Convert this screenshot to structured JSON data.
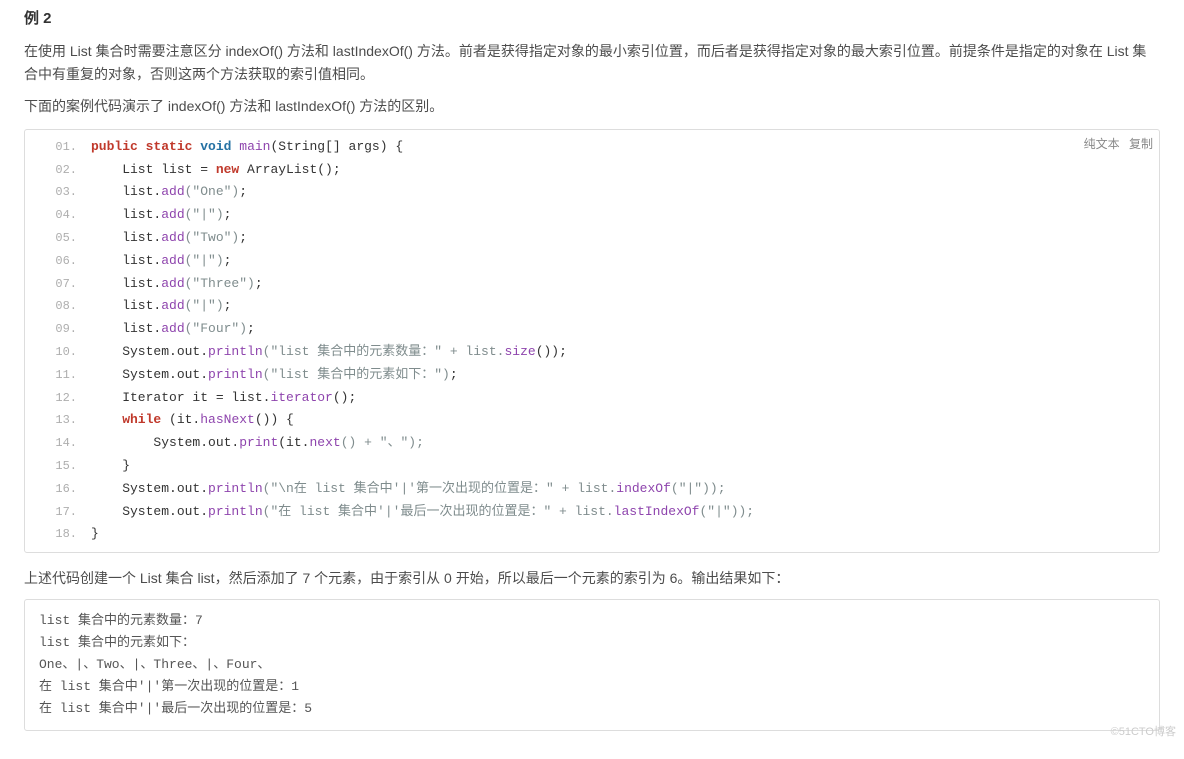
{
  "heading": "例 2",
  "para1": "在使用 List 集合时需要注意区分 indexOf() 方法和 lastIndexOf() 方法。前者是获得指定对象的最小索引位置，而后者是获得指定对象的最大索引位置。前提条件是指定的对象在 List 集合中有重复的对象，否则这两个方法获取的索引值相同。",
  "para2": "下面的案例代码演示了 indexOf() 方法和 lastIndexOf() 方法的区别。",
  "actions": {
    "plain": "纯文本",
    "copy": "复制"
  },
  "code": {
    "l1": {
      "kw1": "public",
      "kw2": "static",
      "kw3": "void",
      "fn": "main",
      "rest": "(String[] args) {"
    },
    "l2": {
      "pre": "    List list = ",
      "kw": "new",
      "post": " ArrayList();"
    },
    "l3": {
      "pre": "    list.",
      "fn": "add",
      "arg": "(\"One\")",
      "end": ";"
    },
    "l4": {
      "pre": "    list.",
      "fn": "add",
      "arg": "(\"|\")",
      "end": ";"
    },
    "l5": {
      "pre": "    list.",
      "fn": "add",
      "arg": "(\"Two\")",
      "end": ";"
    },
    "l6": {
      "pre": "    list.",
      "fn": "add",
      "arg": "(\"|\")",
      "end": ";"
    },
    "l7": {
      "pre": "    list.",
      "fn": "add",
      "arg": "(\"Three\")",
      "end": ";"
    },
    "l8": {
      "pre": "    list.",
      "fn": "add",
      "arg": "(\"|\")",
      "end": ";"
    },
    "l9": {
      "pre": "    list.",
      "fn": "add",
      "arg": "(\"Four\")",
      "end": ";"
    },
    "l10": {
      "pre": "    System.out.",
      "fn": "println",
      "str": "(\"list 集合中的元素数量：\" + list.",
      "fn2": "size",
      "end": "());"
    },
    "l11": {
      "pre": "    System.out.",
      "fn": "println",
      "str": "(\"list 集合中的元素如下：\")",
      "end": ";"
    },
    "l12": {
      "pre": "    Iterator it = list.",
      "fn": "iterator",
      "end": "();"
    },
    "l13": {
      "kw": "    while",
      "rest": " (it.",
      "fn": "hasNext",
      "end": "()) {"
    },
    "l14": {
      "pre": "        System.out.",
      "fn": "print",
      "mid": "(it.",
      "fn2": "next",
      "end": "() + \"、\");"
    },
    "l15": {
      "txt": "    }"
    },
    "l16": {
      "pre": "    System.out.",
      "fn": "println",
      "str": "(\"\\n在 list 集合中'|'第一次出现的位置是：\" + list.",
      "fn2": "indexOf",
      "end": "(\"|\"));"
    },
    "l17": {
      "pre": "    System.out.",
      "fn": "println",
      "str": "(\"在 list 集合中'|'最后一次出现的位置是：\" + list.",
      "fn2": "lastIndexOf",
      "end": "(\"|\"));"
    },
    "l18": {
      "txt": "}"
    }
  },
  "para3": "上述代码创建一个 List 集合 list，然后添加了 7 个元素，由于索引从 0 开始，所以最后一个元素的索引为 6。输出结果如下：",
  "output": "list 集合中的元素数量：7\nlist 集合中的元素如下：\nOne、|、Two、|、Three、|、Four、\n在 list 集合中'|'第一次出现的位置是：1\n在 list 集合中'|'最后一次出现的位置是：5",
  "watermark": "©51CTO博客"
}
